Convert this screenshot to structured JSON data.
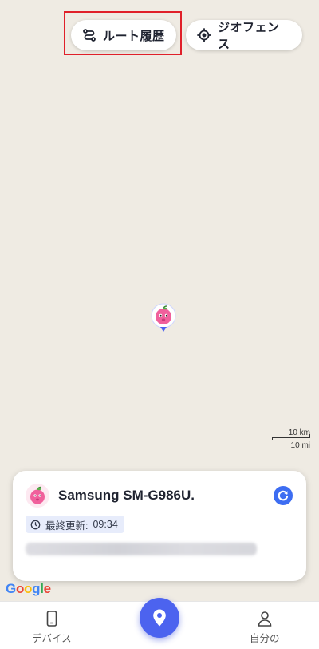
{
  "map_toolbar": {
    "route_history_label": "ルート履歴",
    "geofence_label": "ジオフェンス"
  },
  "scale": {
    "km_label": "10 km",
    "mi_label": "10 mi"
  },
  "device_card": {
    "device_name": "Samsung SM-G986U.",
    "last_updated_label": "最終更新:",
    "last_updated_time": "09:34"
  },
  "attribution": {
    "google_letters": [
      "G",
      "o",
      "o",
      "g",
      "l",
      "e"
    ],
    "google_colors": [
      "#4285F4",
      "#EA4335",
      "#FBBC05",
      "#4285F4",
      "#34A853",
      "#EA4335"
    ]
  },
  "bottom_nav": {
    "devices_label": "デバイス",
    "self_label": "自分の"
  },
  "colors": {
    "accent": "#4c63ef",
    "highlight_border": "#e0202a",
    "map_background": "#efebe3"
  }
}
